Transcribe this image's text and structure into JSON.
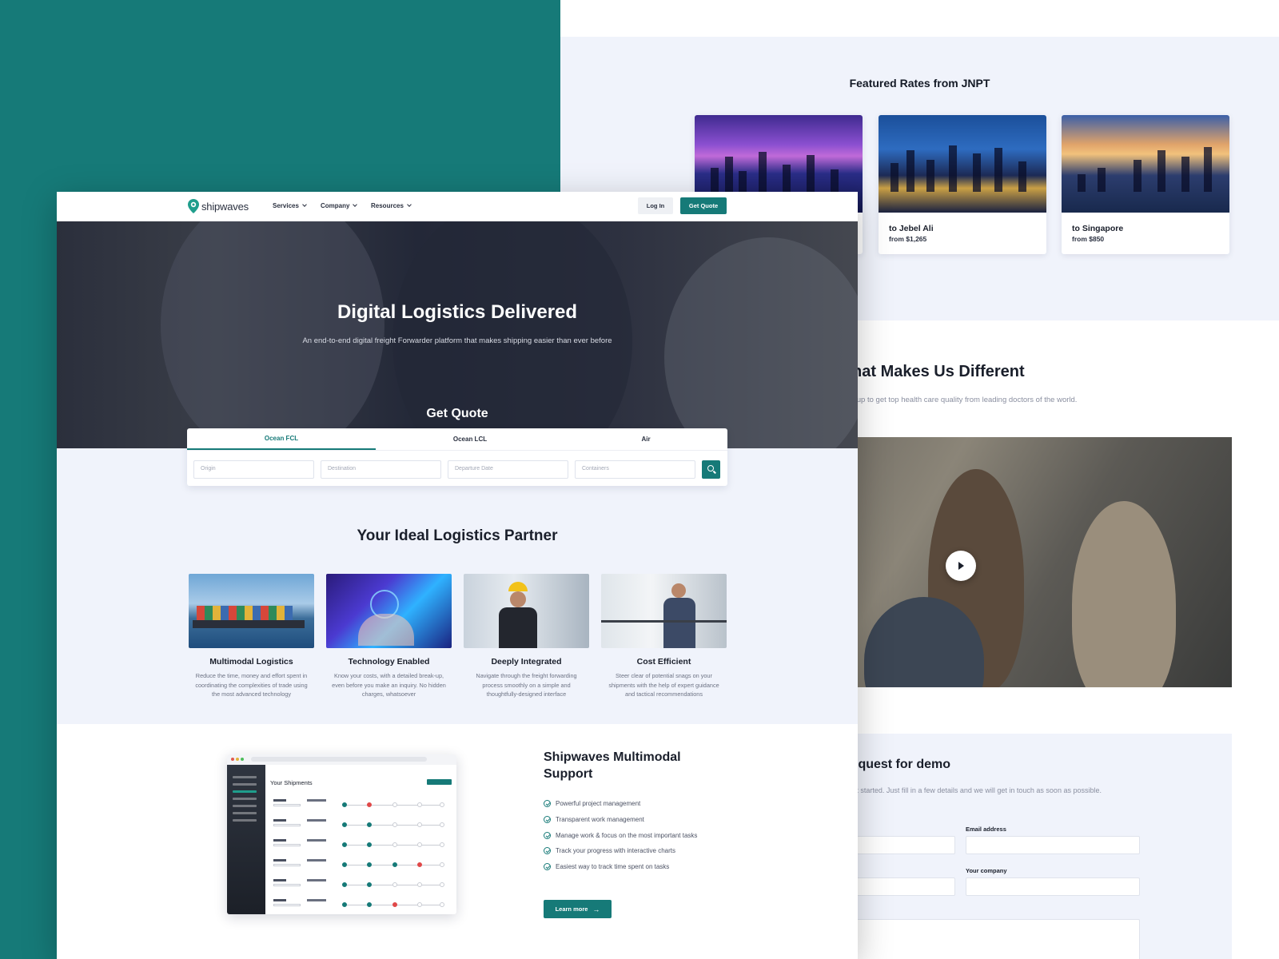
{
  "featured": {
    "title": "Featured Rates from JNPT",
    "rates": [
      {
        "destination": "",
        "price": ""
      },
      {
        "destination": "to Jebel Ali",
        "price": "from $1,265"
      },
      {
        "destination": "to Singapore",
        "price": "from $850"
      }
    ]
  },
  "different": {
    "title": "ee What Makes Us Different",
    "subtitle": "est care begins here. Hurry up to get top health care quality from leading doctors of the world."
  },
  "demo": {
    "title": "Request for demo",
    "subtitle": "at you have seen? Let's get started. Just fill in a few details and we will get in touch as soon as possible.",
    "email_label": "Email address",
    "company_label": "Your company"
  },
  "nav": {
    "brand": "shipwaves",
    "services": "Services",
    "company": "Company",
    "resources": "Resources",
    "login": "Log In",
    "get_quote": "Get Quote"
  },
  "hero": {
    "title": "Digital Logistics Delivered",
    "subtitle": "An end-to-end digital freight Forwarder platform that makes shipping easier than ever before",
    "quote_title": "Get Quote"
  },
  "quote": {
    "tabs": [
      "Ocean FCL",
      "Ocean LCL",
      "Air"
    ],
    "origin_placeholder": "Origin",
    "destination_placeholder": "Destination",
    "date_placeholder": "Departure Date",
    "containers_placeholder": "Containers"
  },
  "partner": {
    "title": "Your Ideal Logistics Partner",
    "features": [
      {
        "title": "Multimodal Logistics",
        "desc": "Reduce the time, money and effort spent in coordinating the complexities of trade using the most advanced technology"
      },
      {
        "title": "Technology Enabled",
        "desc": "Know your costs, with a detailed break-up, even before you make an inquiry. No hidden charges, whatsoever"
      },
      {
        "title": "Deeply Integrated",
        "desc": "Navigate through the freight forwarding process smoothly on a simple and thoughtfully-designed interface"
      },
      {
        "title": "Cost Efficient",
        "desc": "Steer clear of potential snags on your shipments with the help of expert guidance and tactical recommendations"
      }
    ]
  },
  "mockup": {
    "title": "Your Shipments"
  },
  "support": {
    "title": "Shipwaves Multimodal Support",
    "items": [
      "Powerful project management",
      "Transparent work management",
      "Manage work & focus on the most important tasks",
      "Track your progress with interactive charts",
      "Easiest way to track time spent on tasks"
    ],
    "cta": "Learn more"
  },
  "colors": {
    "brand_teal": "#167a78",
    "light_section": "#f0f3fb",
    "alert_red": "#e04848"
  }
}
